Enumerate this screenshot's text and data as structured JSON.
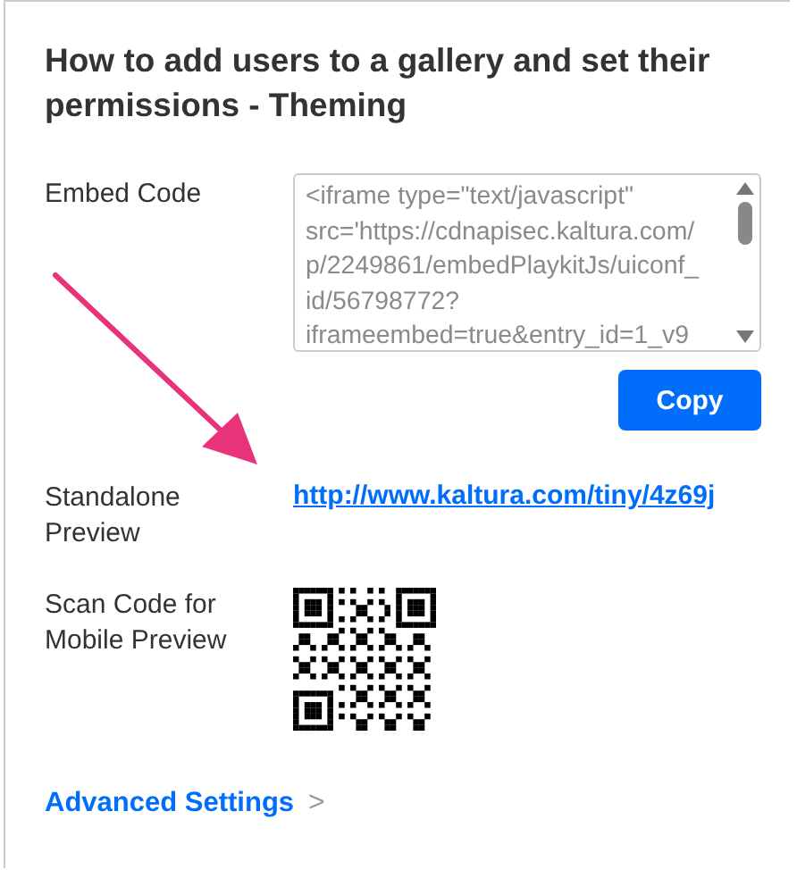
{
  "title": "How to add users to a gallery and set their permissions - Theming",
  "embed": {
    "label": "Embed Code",
    "lines": [
      "<iframe type=\"text/javascript\"",
      "src='https://cdnapisec.kaltura.com/",
      "p/2249861/embedPlaykitJs/uiconf_",
      "id/56798772?",
      "iframeembed=true&entry_id=1_v9"
    ],
    "button": "Copy"
  },
  "standalone": {
    "label": "Standalone Preview",
    "link": "http://www.kaltura.com/tiny/4z69j"
  },
  "scan": {
    "label": "Scan Code for Mobile Preview"
  },
  "advanced": {
    "label": "Advanced Settings",
    "chevron": ">"
  }
}
